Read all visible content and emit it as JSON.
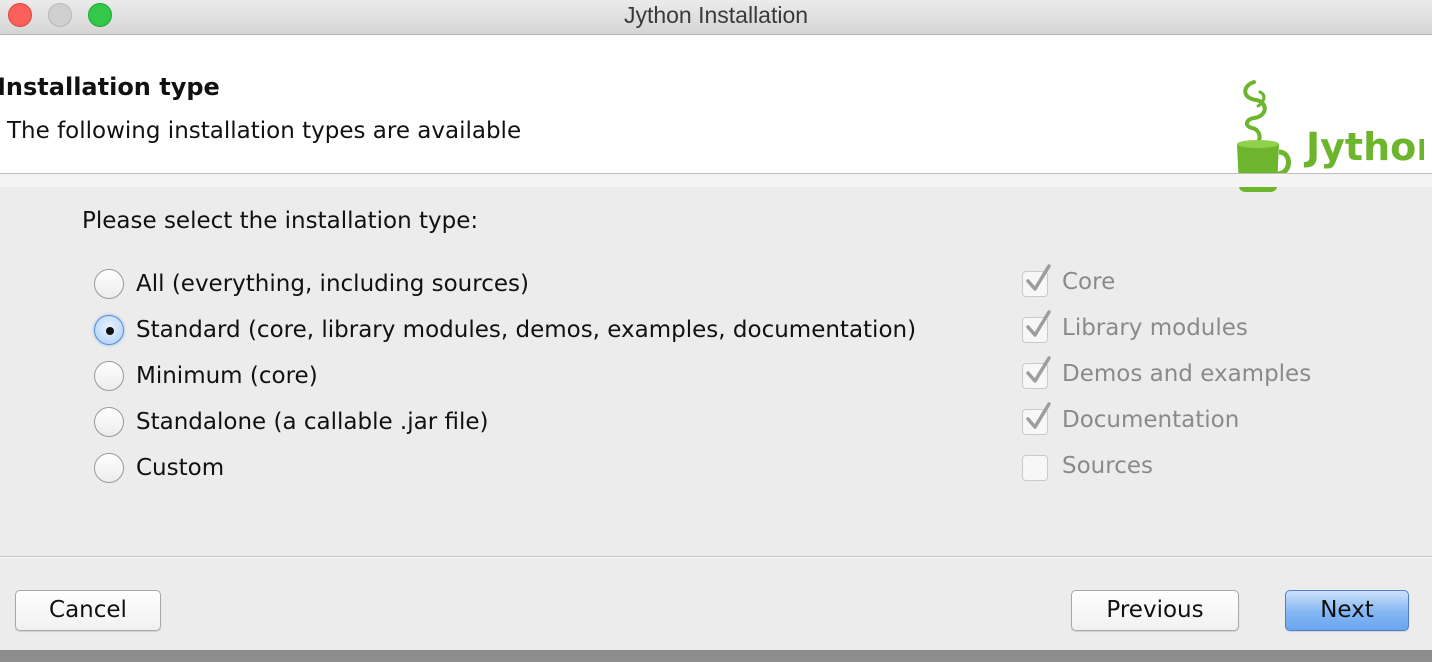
{
  "window": {
    "title": "Jython Installation"
  },
  "header": {
    "title": "Installation type",
    "subtitle": "The following installation types are available",
    "logo_text": "Jython"
  },
  "prompt": "Please select the installation type:",
  "install_types": [
    {
      "label": "All (everything, including sources)",
      "selected": false
    },
    {
      "label": "Standard (core, library modules, demos, examples, documentation)",
      "selected": true
    },
    {
      "label": "Minimum (core)",
      "selected": false
    },
    {
      "label": "Standalone (a callable .jar file)",
      "selected": false
    },
    {
      "label": "Custom",
      "selected": false
    }
  ],
  "components": [
    {
      "label": "Core",
      "checked": true,
      "enabled": false
    },
    {
      "label": "Library modules",
      "checked": true,
      "enabled": false
    },
    {
      "label": "Demos and examples",
      "checked": true,
      "enabled": false
    },
    {
      "label": "Documentation",
      "checked": true,
      "enabled": false
    },
    {
      "label": "Sources",
      "checked": false,
      "enabled": false
    }
  ],
  "buttons": {
    "cancel": "Cancel",
    "previous": "Previous",
    "next": "Next"
  },
  "colors": {
    "logo_green": "#6cb52d",
    "primary_button": "#83b6f3",
    "selected_radio": "#a9cdf7"
  }
}
